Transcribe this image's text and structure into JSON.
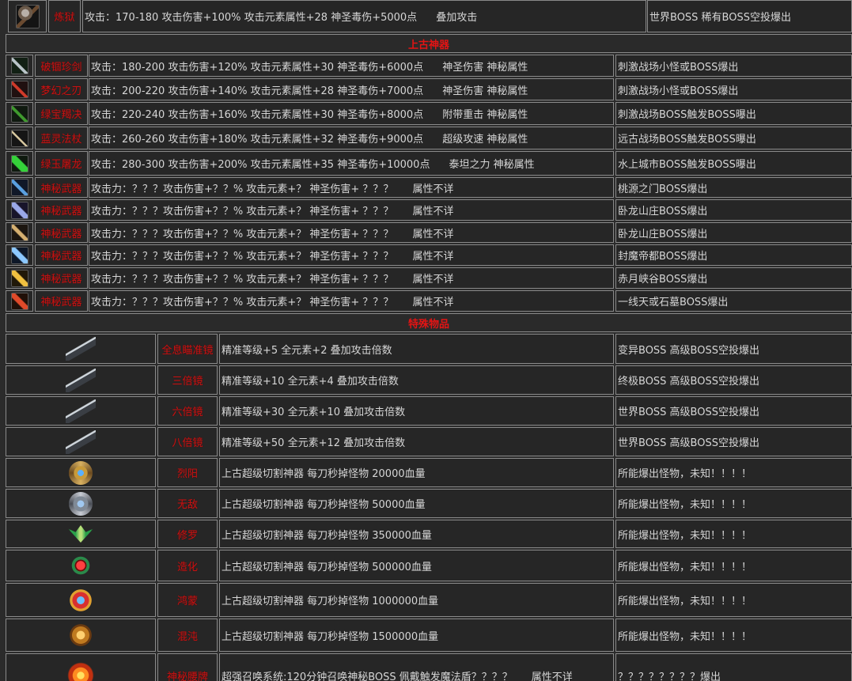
{
  "table": {
    "top_row": {
      "icon": "battle-axe-icon",
      "name": "炼狱",
      "attr": "攻击：170-180 攻击伤害+100% 攻击元素属性+28 神圣毒伤+5000点",
      "special": "叠加攻击",
      "source": "世界BOSS 稀有BOSS空投爆出"
    },
    "sections": [
      {
        "title": "上古神器",
        "rows": [
          {
            "icon": "sword-icon",
            "name": "破锢珍剑",
            "attr": "攻击：180-200 攻击伤害+120% 攻击元素属性+30 神圣毒伤+6000点",
            "special": "神圣伤害  神秘属性",
            "source": "刺激战场小怪或BOSS爆出"
          },
          {
            "icon": "red-sword-icon",
            "name": "梦幻之刃",
            "attr": "攻击：200-220 攻击伤害+140% 攻击元素属性+28 神圣毒伤+7000点",
            "special": "神圣伤害  神秘属性",
            "source": "刺激战场小怪或BOSS爆出"
          },
          {
            "icon": "green-sword-icon",
            "name": "绿宝羯决",
            "attr": "攻击：220-240 攻击伤害+160% 攻击元素属性+30 神圣毒伤+8000点",
            "special": "附带重击  神秘属性",
            "source": "刺激战场BOSS触发BOSS曝出"
          },
          {
            "icon": "staff-icon",
            "name": "蓝灵法杖",
            "attr": "攻击：260-260 攻击伤害+180% 攻击元素属性+32 神圣毒伤+9000点",
            "special": "超级攻速  神秘属性",
            "source": "远古战场BOSS触发BOSS曝出"
          },
          {
            "icon": "jade-blade-icon",
            "name": "绿玉屠龙",
            "attr": "攻击：280-300 攻击伤害+200% 攻击元素属性+35 神圣毒伤+10000点",
            "special": "泰坦之力  神秘属性",
            "source": "水上城市BOSS触发BOSS曝出"
          },
          {
            "icon": "mystic-weapon-icon",
            "name": "神秘武器",
            "attr": "攻击力：？？？攻击伤害+？？% 攻击元素+？ 神圣伤害+ ？？？",
            "special": "属性不详",
            "source": "桃源之门BOSS爆出"
          },
          {
            "icon": "mystic-weapon-icon",
            "name": "神秘武器",
            "attr": "攻击力：？？？攻击伤害+？？% 攻击元素+？ 神圣伤害+ ？？？",
            "special": "属性不详",
            "source": "卧龙山庄BOSS爆出"
          },
          {
            "icon": "mystic-weapon-icon",
            "name": "神秘武器",
            "attr": "攻击力：？？？攻击伤害+？？% 攻击元素+？ 神圣伤害+ ？？？",
            "special": "属性不详",
            "source": "卧龙山庄BOSS爆出"
          },
          {
            "icon": "mystic-weapon-icon",
            "name": "神秘武器",
            "attr": "攻击力：？？？攻击伤害+？？% 攻击元素+？ 神圣伤害+ ？？？",
            "special": "属性不详",
            "source": "封魔帝都BOSS爆出"
          },
          {
            "icon": "mystic-weapon-icon",
            "name": "神秘武器",
            "attr": "攻击力：？？？攻击伤害+？？% 攻击元素+？ 神圣伤害+ ？？？",
            "special": "属性不详",
            "source": "赤月峡谷BOSS爆出"
          },
          {
            "icon": "mystic-weapon-icon",
            "name": "神秘武器",
            "attr": "攻击力：？？？攻击伤害+？？% 攻击元素+？ 神圣伤害+ ？？？",
            "special": "属性不详",
            "source": "一线天或石墓BOSS爆出"
          }
        ]
      },
      {
        "title": "特殊物品",
        "rows": [
          {
            "icon": "scope-icon",
            "name": "全息瞄准镜",
            "attr": "精准等级+5 全元素+2 叠加攻击倍数",
            "source": "变异BOSS 高级BOSS空投爆出"
          },
          {
            "icon": "scope-icon",
            "name": "三倍镜",
            "attr": "精准等级+10 全元素+4 叠加攻击倍数",
            "source": "终极BOSS 高级BOSS空投爆出"
          },
          {
            "icon": "scope-icon",
            "name": "六倍镜",
            "attr": "精准等级+30 全元素+10 叠加攻击倍数",
            "source": "世界BOSS 高级BOSS空投爆出"
          },
          {
            "icon": "scope-icon",
            "name": "八倍镜",
            "attr": "精准等级+50 全元素+12 叠加攻击倍数",
            "source": "世界BOSS 高级BOSS空投爆出"
          },
          {
            "icon": "gold-badge-icon",
            "name": "烈阳",
            "attr": "上古超级切割神器 每刀秒掉怪物 20000血量",
            "source": "所能爆出怪物，未知！！！！"
          },
          {
            "icon": "silver-badge-icon",
            "name": "无敌",
            "attr": "上古超级切割神器 每刀秒掉怪物 50000血量",
            "source": "所能爆出怪物，未知！！！！"
          },
          {
            "icon": "green-wings-icon",
            "name": "修罗",
            "attr": "上古超级切割神器 每刀秒掉怪物 350000血量",
            "source": "所能爆出怪物，未知！！！！"
          },
          {
            "icon": "red-gem-icon",
            "name": "造化",
            "attr": "上古超级切割神器 每刀秒掉怪物 500000血量",
            "source": "所能爆出怪物，未知！！！！"
          },
          {
            "icon": "winged-emblem-icon",
            "name": "鸿蒙",
            "attr": "上古超级切割神器 每刀秒掉怪物 1000000血量",
            "source": "所能爆出怪物，未知！！！！"
          },
          {
            "icon": "gold-emblem-icon",
            "name": "混沌",
            "attr": "上古超级切割神器 每刀秒掉怪物 1500000血量",
            "source": "所能爆出怪物，未知！！！！"
          },
          {
            "icon": "flame-emblem-icon",
            "name": "神秘腰牌",
            "attr": "超强召唤系统:120分钟召唤神秘BOSS 佩戴触发魔法盾？？？？",
            "special": "属性不详",
            "source": "？？？？？？？？爆出"
          }
        ]
      }
    ]
  }
}
